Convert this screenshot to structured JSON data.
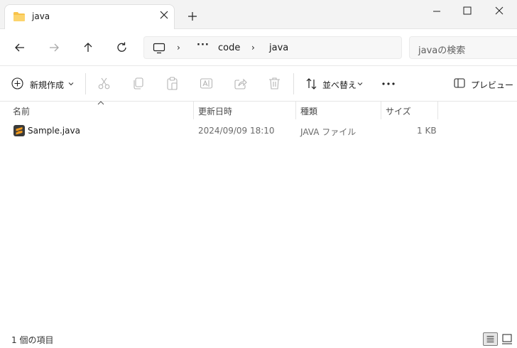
{
  "window": {
    "tab_title": "java",
    "tab_icon": "folder-icon",
    "folder_color": "#f8c34a"
  },
  "address": {
    "more": "···",
    "crumbs": [
      "code",
      "java"
    ],
    "search_placeholder": "javaの検索"
  },
  "toolbar": {
    "new_label": "新規作成",
    "sort_label": "並べ替え",
    "more_label": "···",
    "preview_label": "プレビュー",
    "icons": [
      "cut-icon",
      "copy-icon",
      "paste-icon",
      "rename-icon",
      "share-icon",
      "delete-icon"
    ]
  },
  "columns": {
    "name": "名前",
    "date": "更新日時",
    "type": "種類",
    "size": "サイズ"
  },
  "files": [
    {
      "name": "Sample.java",
      "date": "2024/09/09 18:10",
      "type": "JAVA ファイル",
      "size": "1 KB",
      "icon": "sublime-text-icon",
      "icon_color": "#f29b1d"
    }
  ],
  "status": {
    "item_count": "1 個の項目"
  }
}
